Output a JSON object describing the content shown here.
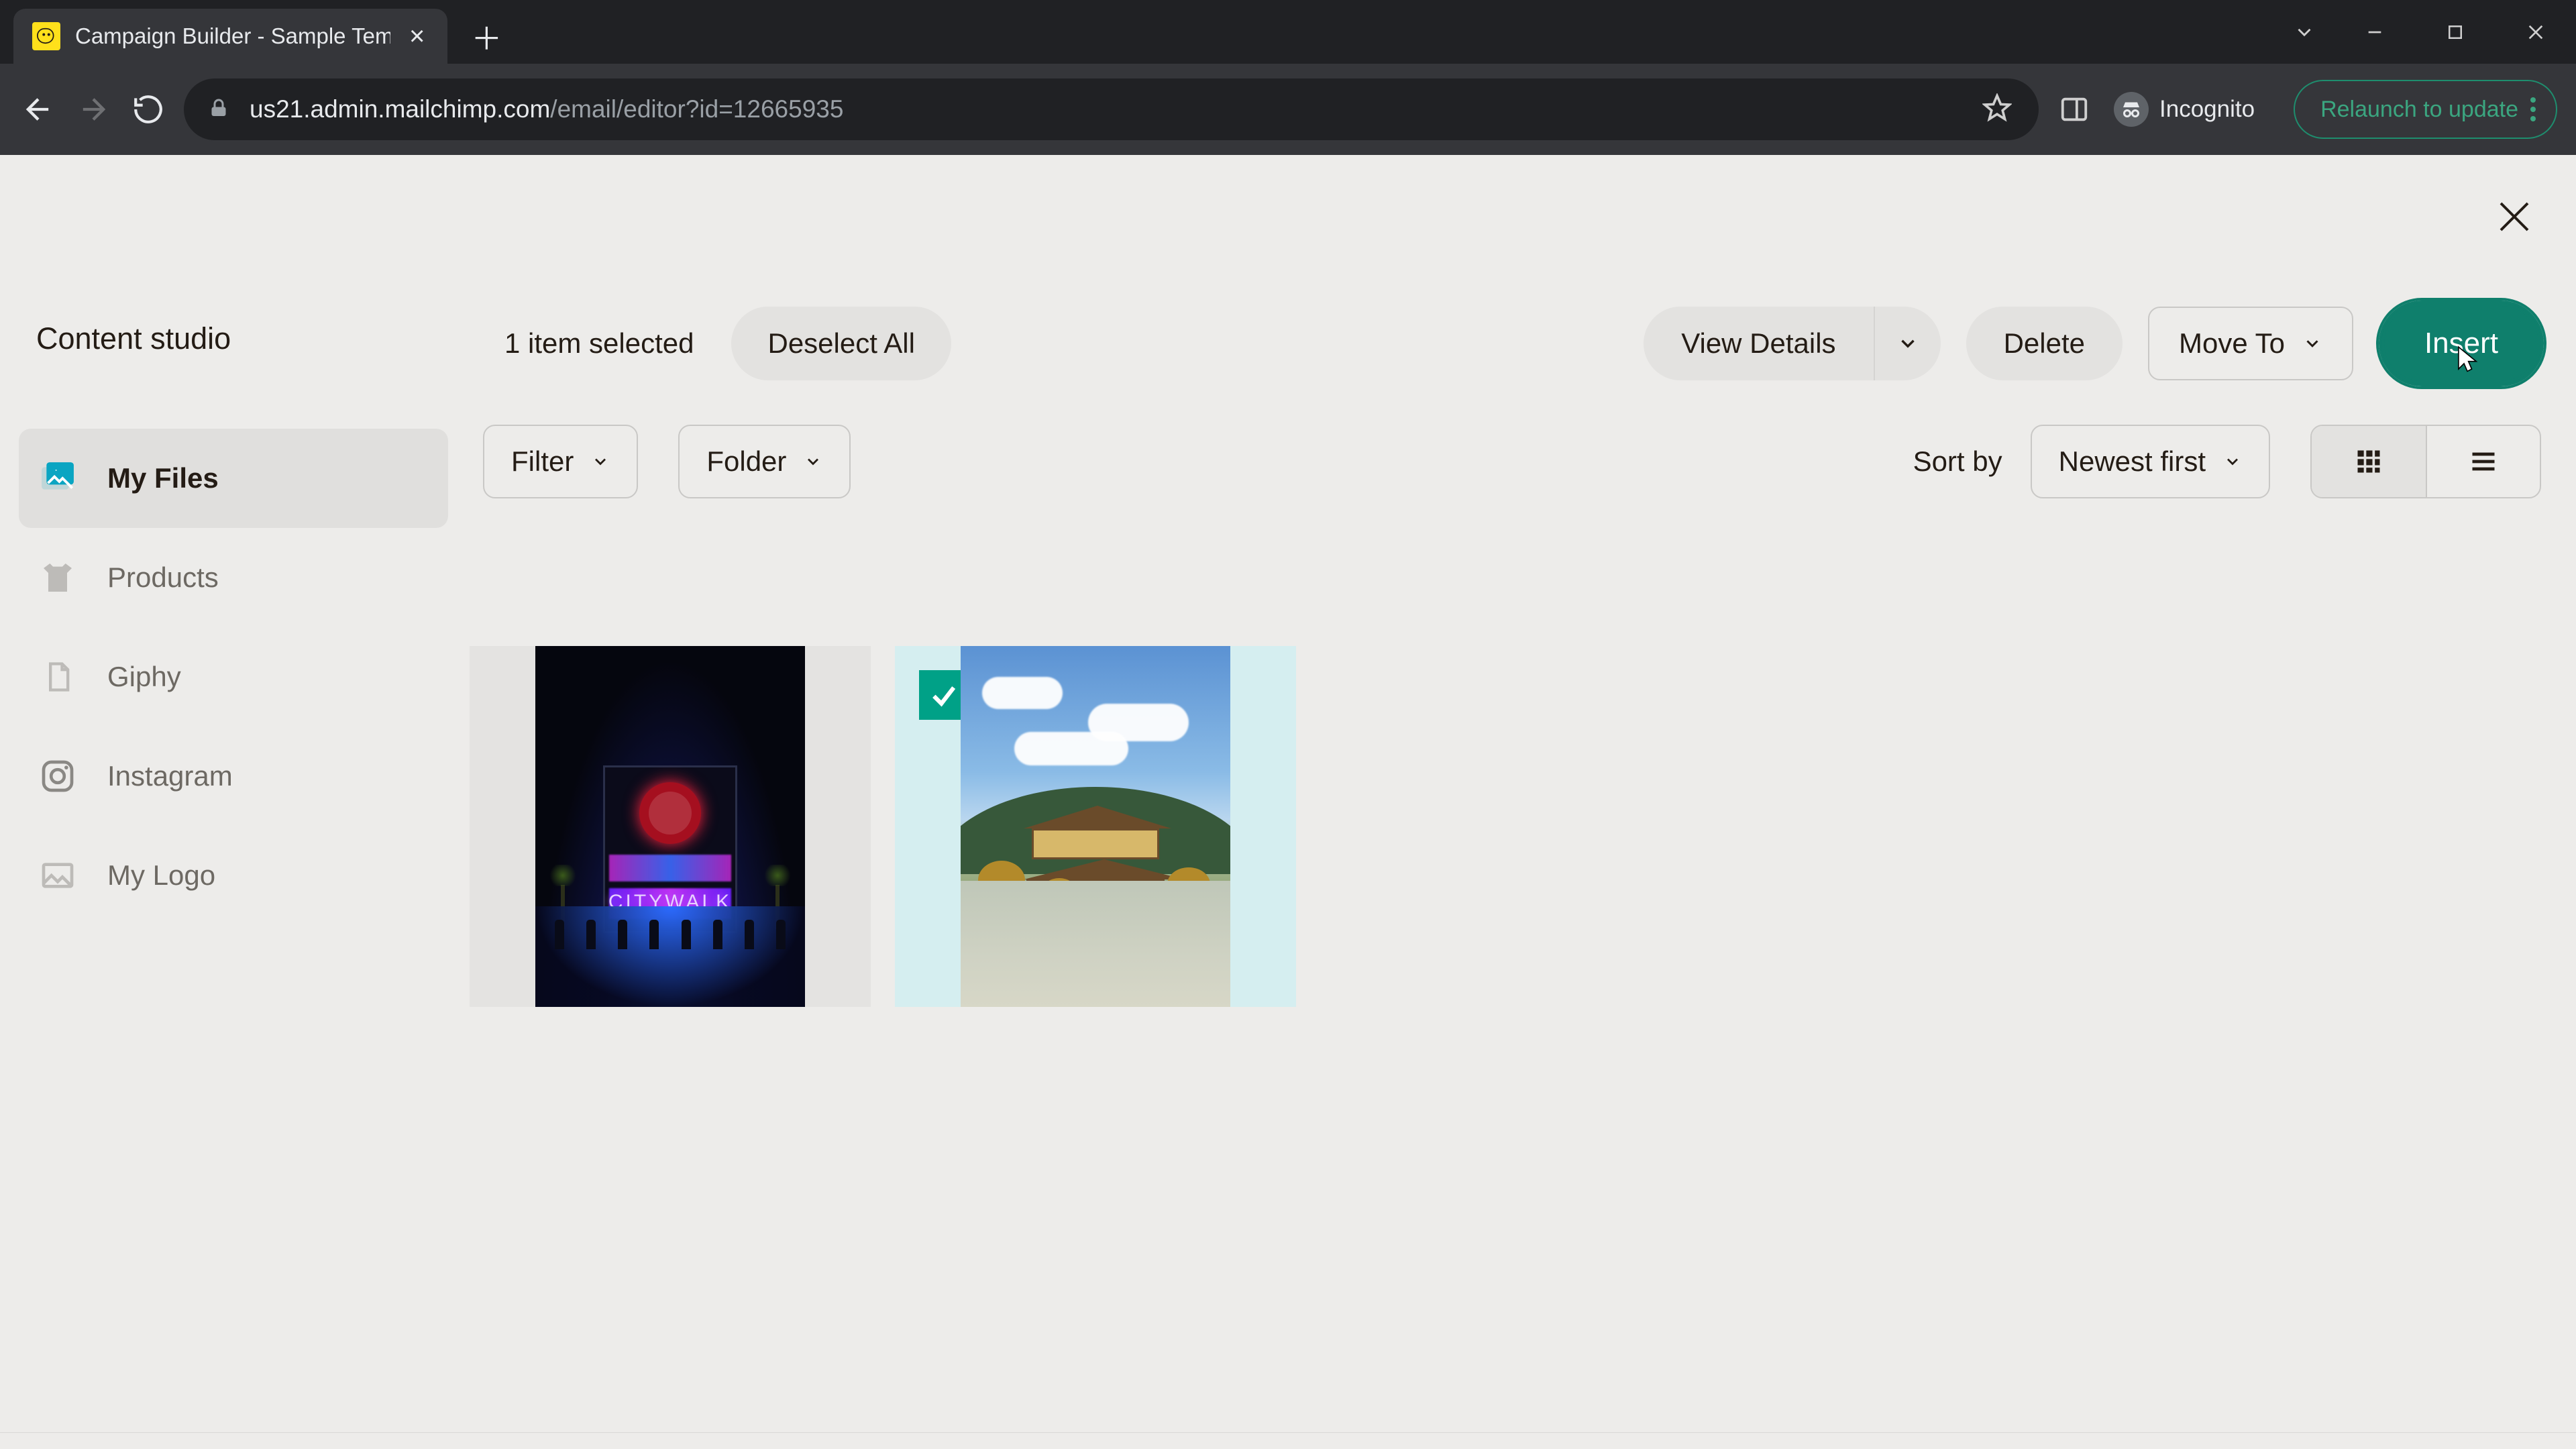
{
  "browser": {
    "tab_title": "Campaign Builder - Sample Tem",
    "url_host": "us21.admin.mailchimp.com",
    "url_path": "/email/editor?id=12665935",
    "incognito_label": "Incognito",
    "relaunch_label": "Relaunch to update"
  },
  "page_title": "Content studio",
  "sidebar": {
    "items": [
      {
        "key": "my-files",
        "label": "My Files",
        "active": true
      },
      {
        "key": "products",
        "label": "Products",
        "active": false
      },
      {
        "key": "giphy",
        "label": "Giphy",
        "active": false
      },
      {
        "key": "instagram",
        "label": "Instagram",
        "active": false
      },
      {
        "key": "my-logo",
        "label": "My Logo",
        "active": false
      }
    ]
  },
  "actions": {
    "selection_text": "1 item selected",
    "deselect": "Deselect All",
    "view_details": "View Details",
    "delete": "Delete",
    "move_to": "Move To",
    "insert": "Insert"
  },
  "filters": {
    "filter_label": "Filter",
    "folder_label": "Folder",
    "sort_label": "Sort by",
    "sort_value": "Newest first"
  },
  "thumbs": [
    {
      "name": "neon-city",
      "selected": false
    },
    {
      "name": "golden-pavilion",
      "selected": true
    }
  ],
  "colors": {
    "accent": "#0f7f6c",
    "check": "#00a187",
    "page_bg": "#edecea"
  }
}
